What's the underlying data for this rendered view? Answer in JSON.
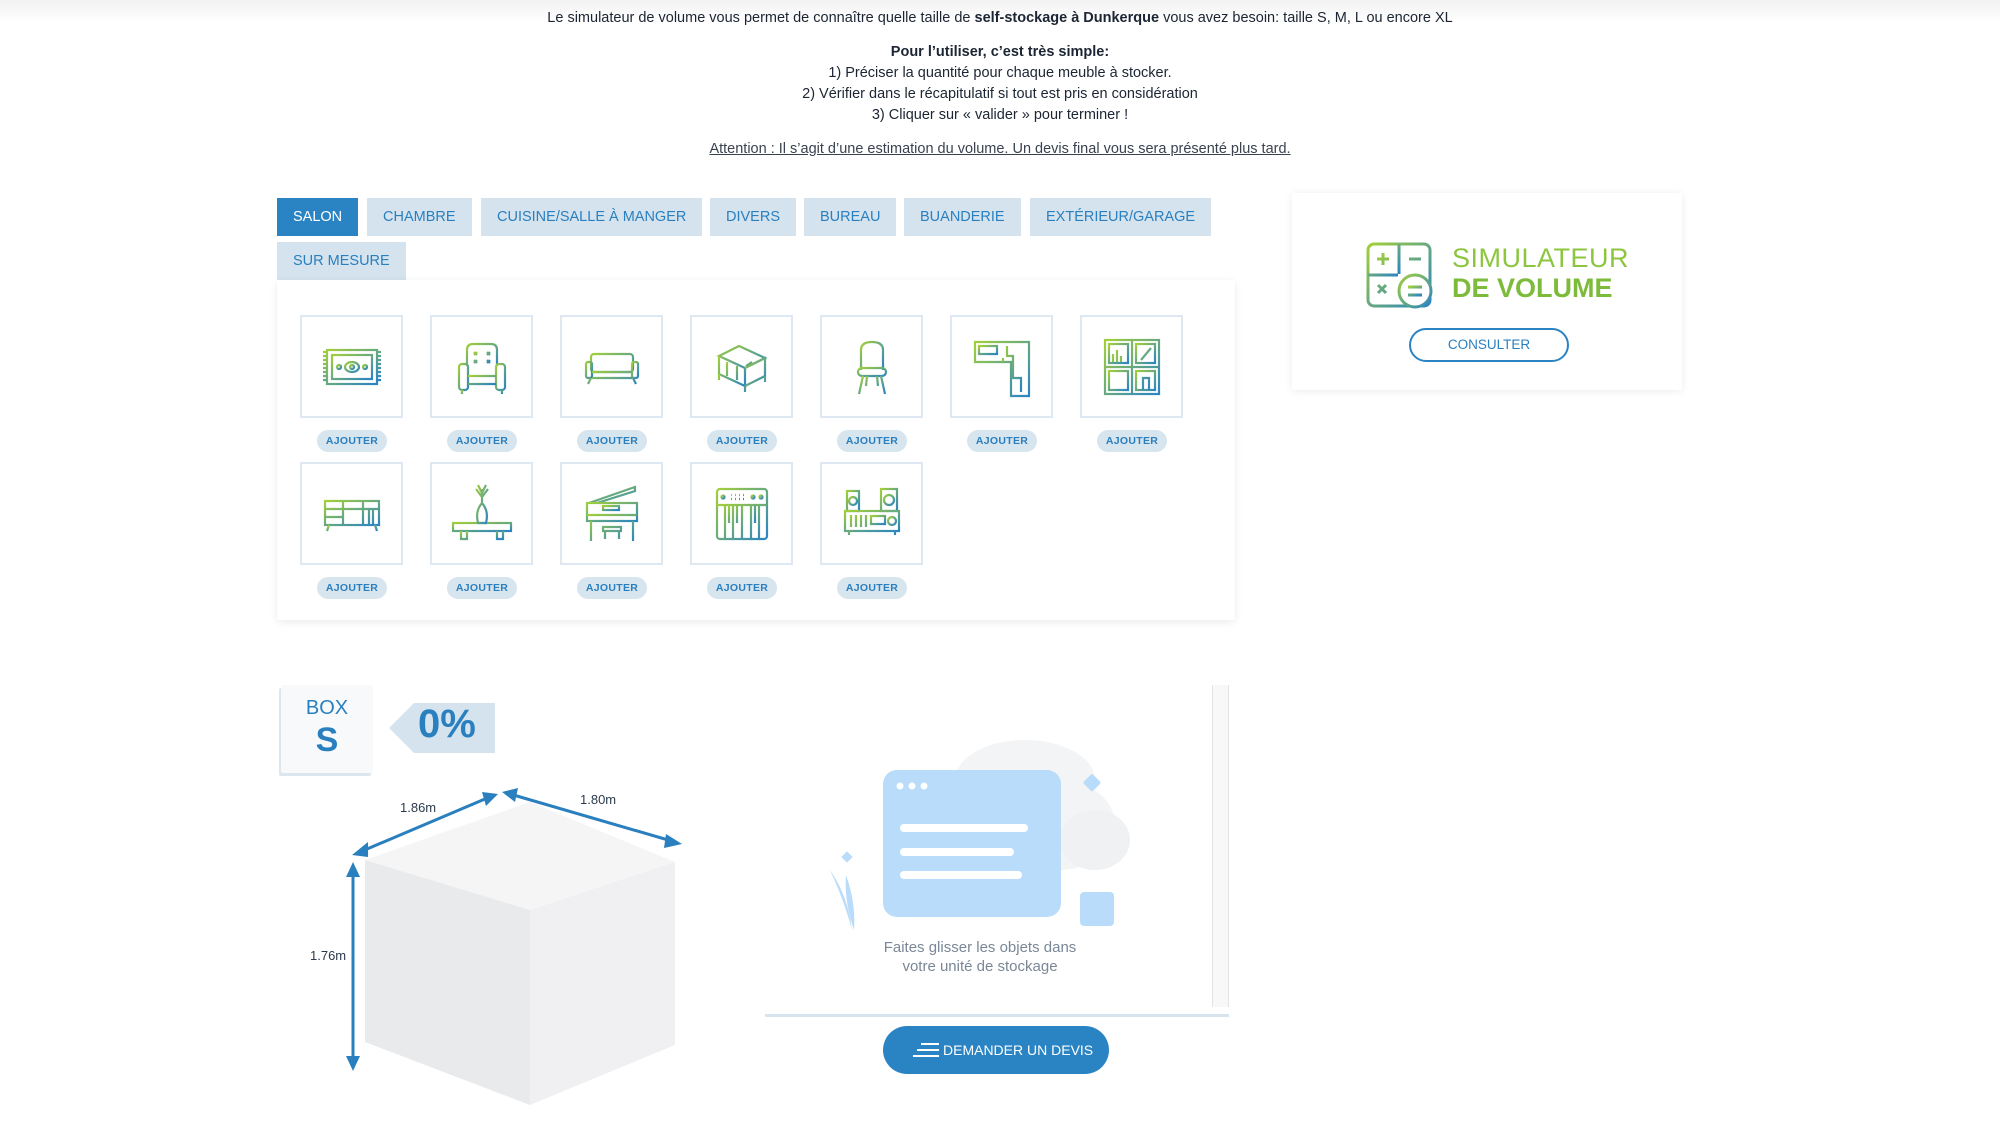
{
  "intro": {
    "line1_before": "Le simulateur de volume vous permet de connaître quelle taille de ",
    "line1_bold": "self-stockage à Dunkerque",
    "line1_after": " vous avez besoin: taille S, M, L ou encore XL",
    "howto_title": "Pour l’utiliser, c’est très simple:",
    "steps": [
      "1) Préciser la quantité pour chaque meuble à stocker.",
      "2) Vérifier dans le récapitulatif si tout est pris en considération",
      "3) Cliquer sur « valider » pour terminer !"
    ],
    "warning": "Attention : Il s’agit d’une estimation du volume. Un devis final vous sera présenté plus tard."
  },
  "tabs": [
    {
      "label": "SALON",
      "active": true
    },
    {
      "label": "CHAMBRE",
      "active": false
    },
    {
      "label": "CUISINE/SALLE À MANGER",
      "active": false
    },
    {
      "label": "DIVERS",
      "active": false
    },
    {
      "label": "BUREAU",
      "active": false
    },
    {
      "label": "BUANDERIE",
      "active": false
    },
    {
      "label": "EXTÉRIEUR/GARAGE",
      "active": false
    },
    {
      "label": "SUR MESURE",
      "active": false
    }
  ],
  "items": [
    {
      "icon": "rug-icon",
      "button": "AJOUTER"
    },
    {
      "icon": "armchair-icon",
      "button": "AJOUTER"
    },
    {
      "icon": "sofa-icon",
      "button": "AJOUTER"
    },
    {
      "icon": "couch-isometric-icon",
      "button": "AJOUTER"
    },
    {
      "icon": "chair-icon",
      "button": "AJOUTER"
    },
    {
      "icon": "corner-desk-icon",
      "button": "AJOUTER"
    },
    {
      "icon": "bookshelf-icon",
      "button": "AJOUTER"
    },
    {
      "icon": "sideboard-icon",
      "button": "AJOUTER"
    },
    {
      "icon": "plant-shelf-icon",
      "button": "AJOUTER"
    },
    {
      "icon": "piano-icon",
      "button": "AJOUTER"
    },
    {
      "icon": "keyboard-synth-icon",
      "button": "AJOUTER"
    },
    {
      "icon": "hifi-system-icon",
      "button": "AJOUTER"
    }
  ],
  "simulator_card": {
    "title_line1": "SIMULATEUR",
    "title_line2": "DE VOLUME",
    "button": "CONSULTER"
  },
  "box": {
    "label": "BOX",
    "size": "S",
    "fill_percent": "0%",
    "depth": "1.86m",
    "width": "1.80m",
    "height": "1.76m"
  },
  "drop_zone": {
    "hint_line1": "Faites glisser les objets dans",
    "hint_line2": "votre unité de stockage"
  },
  "quote_button": "DEMANDER UN DEVIS",
  "colors": {
    "primary": "#2a84c4",
    "tab_bg": "#d4e3ee",
    "brand_green": "#8cc63f"
  }
}
